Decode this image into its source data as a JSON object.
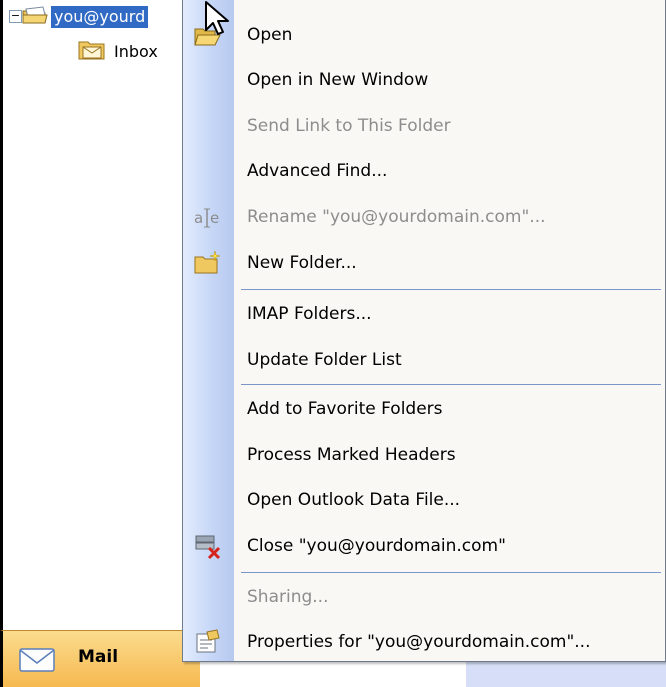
{
  "tree": {
    "expander": "−",
    "root_label": "you@yourd",
    "inbox_label": "Inbox"
  },
  "nav": {
    "mail_label": "Mail"
  },
  "menu": {
    "items": [
      {
        "label": "Open",
        "enabled": true,
        "icon": "open-folder-icon"
      },
      {
        "label": "Open in New Window",
        "enabled": true,
        "icon": ""
      },
      {
        "label": "Send Link to This Folder",
        "enabled": false,
        "icon": ""
      },
      {
        "label": "Advanced Find...",
        "enabled": true,
        "icon": ""
      },
      {
        "label": "Rename \"you@yourdomain.com\"...",
        "enabled": false,
        "icon": "rename-icon"
      },
      {
        "label": "New Folder...",
        "enabled": true,
        "icon": "new-folder-icon"
      },
      {
        "label": "IMAP Folders...",
        "enabled": true,
        "icon": ""
      },
      {
        "label": "Update Folder List",
        "enabled": true,
        "icon": ""
      },
      {
        "label": "Add to Favorite Folders",
        "enabled": true,
        "icon": ""
      },
      {
        "label": "Process Marked Headers",
        "enabled": true,
        "icon": ""
      },
      {
        "label": "Open Outlook Data File...",
        "enabled": true,
        "icon": ""
      },
      {
        "label": "Close \"you@yourdomain.com\"",
        "enabled": true,
        "icon": "close-datafile-icon"
      },
      {
        "label": "Sharing...",
        "enabled": false,
        "icon": ""
      },
      {
        "label": "Properties for \"you@yourdomain.com\"...",
        "enabled": true,
        "icon": "properties-icon"
      }
    ]
  },
  "colors": {
    "selection": "#316ac5",
    "menu_bg": "#f9f8f4",
    "disabled_text": "#8d8d8d",
    "nav_gradient_top": "#fbdc8f",
    "nav_gradient_bottom": "#f6b94f"
  }
}
